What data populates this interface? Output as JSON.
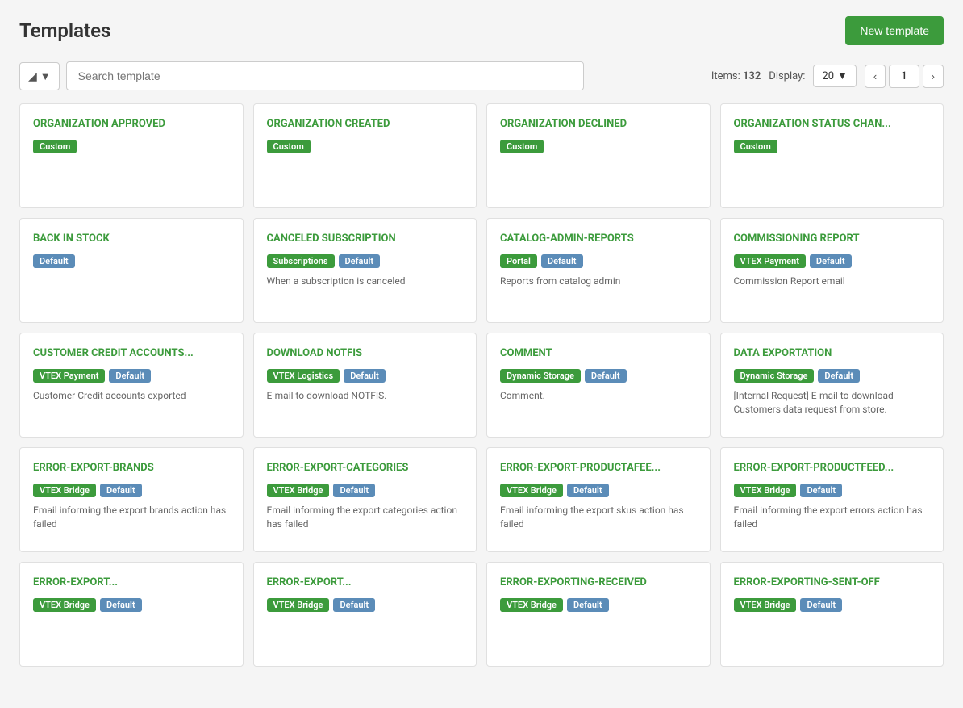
{
  "page": {
    "title": "Templates",
    "new_template_label": "New template"
  },
  "toolbar": {
    "filter_label": "▼",
    "search_placeholder": "Search template",
    "items_label": "Items:",
    "items_count": "132",
    "display_label": "Display:",
    "display_value": "20",
    "page_num": "1"
  },
  "cards": [
    {
      "title": "ORGANIZATION APPROVED",
      "tags": [
        {
          "label": "Custom",
          "type": "tag-custom"
        }
      ],
      "description": ""
    },
    {
      "title": "ORGANIZATION CREATED",
      "tags": [
        {
          "label": "Custom",
          "type": "tag-custom"
        }
      ],
      "description": ""
    },
    {
      "title": "ORGANIZATION DECLINED",
      "tags": [
        {
          "label": "Custom",
          "type": "tag-custom"
        }
      ],
      "description": ""
    },
    {
      "title": "ORGANIZATION STATUS CHAN...",
      "tags": [
        {
          "label": "Custom",
          "type": "tag-custom"
        }
      ],
      "description": ""
    },
    {
      "title": "BACK IN STOCK",
      "tags": [
        {
          "label": "Default",
          "type": "tag-default"
        }
      ],
      "description": ""
    },
    {
      "title": "CANCELED SUBSCRIPTION",
      "tags": [
        {
          "label": "Subscriptions",
          "type": "tag-subscriptions"
        },
        {
          "label": "Default",
          "type": "tag-default"
        }
      ],
      "description": "When a subscription is canceled"
    },
    {
      "title": "CATALOG-ADMIN-REPORTS",
      "tags": [
        {
          "label": "Portal",
          "type": "tag-portal"
        },
        {
          "label": "Default",
          "type": "tag-default"
        }
      ],
      "description": "Reports from catalog admin"
    },
    {
      "title": "COMMISSIONING REPORT",
      "tags": [
        {
          "label": "VTEX Payment",
          "type": "tag-vtex-payment"
        },
        {
          "label": "Default",
          "type": "tag-default"
        }
      ],
      "description": "Commission Report email"
    },
    {
      "title": "CUSTOMER CREDIT ACCOUNTS...",
      "tags": [
        {
          "label": "VTEX Payment",
          "type": "tag-vtex-payment"
        },
        {
          "label": "Default",
          "type": "tag-default"
        }
      ],
      "description": "Customer Credit accounts exported"
    },
    {
      "title": "DOWNLOAD NOTFIS",
      "tags": [
        {
          "label": "VTEX Logistics",
          "type": "tag-vtex-logistics"
        },
        {
          "label": "Default",
          "type": "tag-default"
        }
      ],
      "description": "E-mail to download NOTFIS."
    },
    {
      "title": "COMMENT",
      "tags": [
        {
          "label": "Dynamic Storage",
          "type": "tag-dynamic-storage"
        },
        {
          "label": "Default",
          "type": "tag-default"
        }
      ],
      "description": "Comment."
    },
    {
      "title": "DATA EXPORTATION",
      "tags": [
        {
          "label": "Dynamic Storage",
          "type": "tag-dynamic-storage"
        },
        {
          "label": "Default",
          "type": "tag-default"
        }
      ],
      "description": "[Internal Request] E-mail to download Customers data request from store."
    },
    {
      "title": "ERROR-EXPORT-BRANDS",
      "tags": [
        {
          "label": "VTEX Bridge",
          "type": "tag-vtex-bridge"
        },
        {
          "label": "Default",
          "type": "tag-default"
        }
      ],
      "description": "Email informing the export brands action has failed"
    },
    {
      "title": "ERROR-EXPORT-CATEGORIES",
      "tags": [
        {
          "label": "VTEX Bridge",
          "type": "tag-vtex-bridge"
        },
        {
          "label": "Default",
          "type": "tag-default"
        }
      ],
      "description": "Email informing the export categories action has failed"
    },
    {
      "title": "ERROR-EXPORT-PRODUCTAFEE...",
      "tags": [
        {
          "label": "VTEX Bridge",
          "type": "tag-vtex-bridge"
        },
        {
          "label": "Default",
          "type": "tag-default"
        }
      ],
      "description": "Email informing the export skus action has failed"
    },
    {
      "title": "ERROR-EXPORT-PRODUCTFEED...",
      "tags": [
        {
          "label": "VTEX Bridge",
          "type": "tag-vtex-bridge"
        },
        {
          "label": "Default",
          "type": "tag-default"
        }
      ],
      "description": "Email informing the export errors action has failed"
    },
    {
      "title": "ERROR-EXPORT...",
      "tags": [
        {
          "label": "VTEX Bridge",
          "type": "tag-vtex-bridge"
        },
        {
          "label": "Default",
          "type": "tag-default"
        }
      ],
      "description": ""
    },
    {
      "title": "ERROR-EXPORT...",
      "tags": [
        {
          "label": "VTEX Bridge",
          "type": "tag-vtex-bridge"
        },
        {
          "label": "Default",
          "type": "tag-default"
        }
      ],
      "description": ""
    },
    {
      "title": "ERROR-EXPORTING-RECEIVED",
      "tags": [
        {
          "label": "VTEX Bridge",
          "type": "tag-vtex-bridge"
        },
        {
          "label": "Default",
          "type": "tag-default"
        }
      ],
      "description": ""
    },
    {
      "title": "ERROR-EXPORTING-SENT-OFF",
      "tags": [
        {
          "label": "VTEX Bridge",
          "type": "tag-vtex-bridge"
        },
        {
          "label": "Default",
          "type": "tag-default"
        }
      ],
      "description": ""
    }
  ]
}
